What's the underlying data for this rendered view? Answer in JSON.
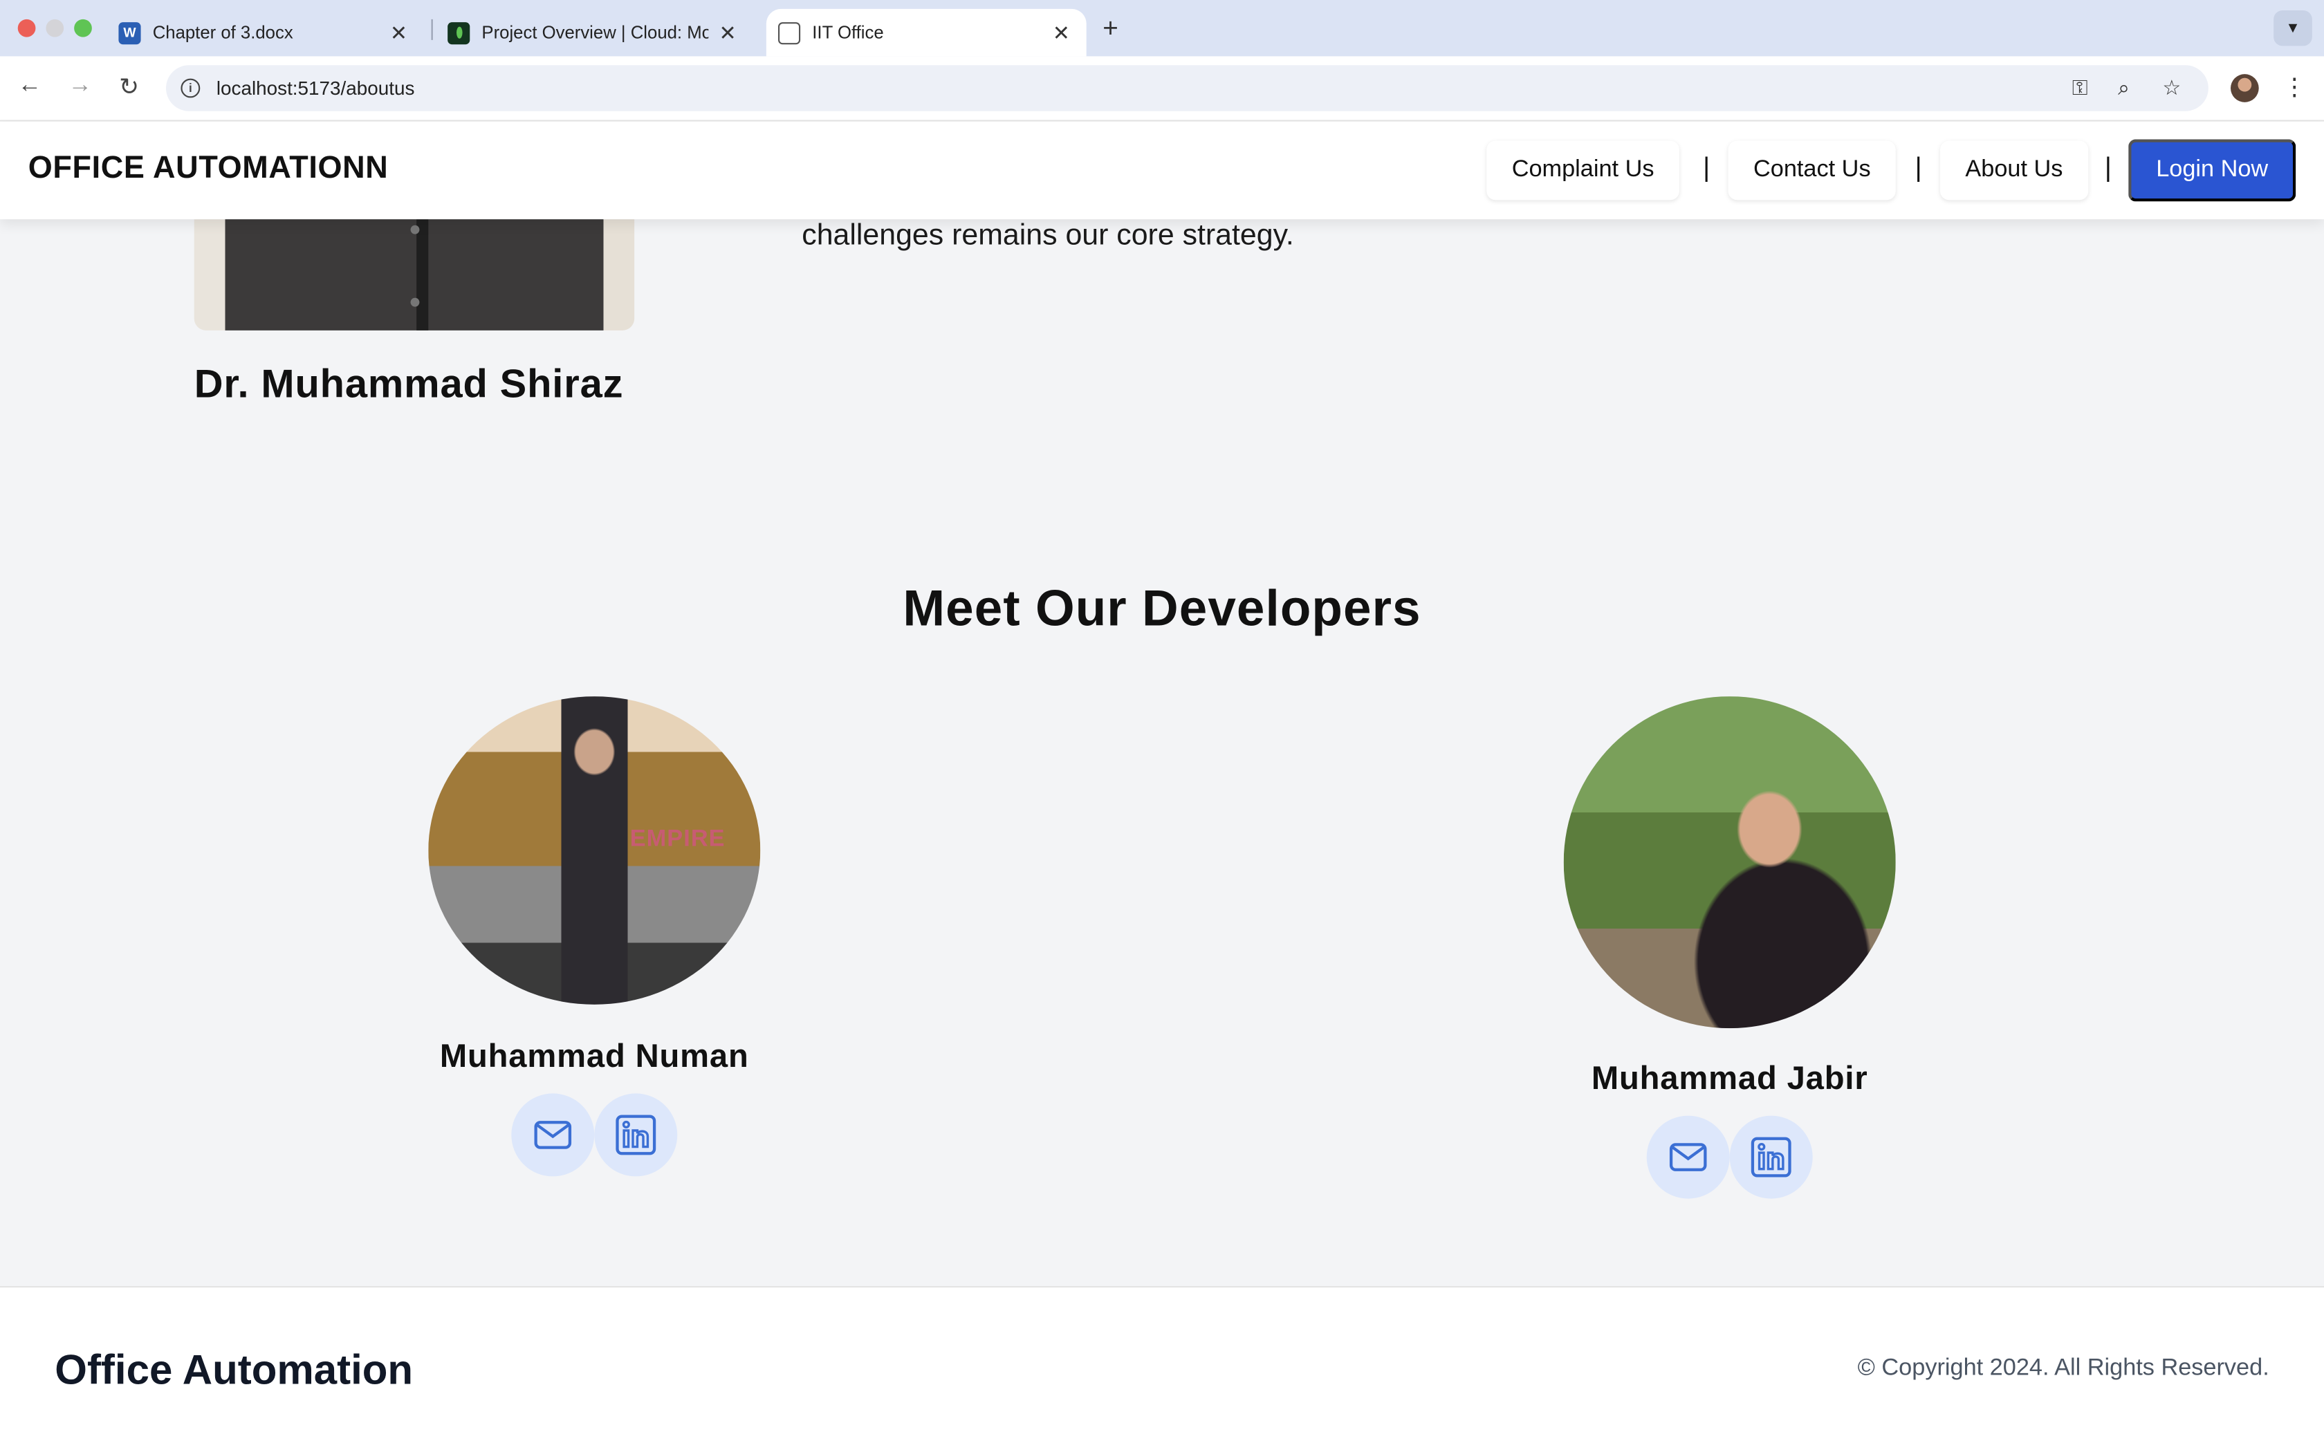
{
  "browser": {
    "tabs": [
      {
        "title": "Chapter of 3.docx",
        "icon": "word-icon",
        "active": false
      },
      {
        "title": "Project Overview | Cloud: MongoDB Cloud",
        "icon": "mongodb-icon",
        "active": false
      },
      {
        "title": "IIT Office",
        "icon": "globe-icon",
        "active": true
      }
    ],
    "url": "localhost:5173/aboutus"
  },
  "header": {
    "brand": "OFFICE AUTOMATIONN",
    "nav": [
      {
        "label": "Complaint Us"
      },
      {
        "label": "Contact Us"
      },
      {
        "label": "About Us"
      }
    ],
    "separator": "|",
    "login_label": "Login Now",
    "accent": "#2a55d2"
  },
  "director": {
    "quote_tail": "challenges remains our core strategy.",
    "name": "Dr. Muhammad Shiraz"
  },
  "developers": {
    "heading": "Meet Our Developers",
    "people": [
      {
        "name": "Muhammad Numan",
        "photo_sign": "EMPIRE",
        "links": [
          "mail-icon",
          "linkedin-icon"
        ]
      },
      {
        "name": "Muhammad Jabir",
        "links": [
          "mail-icon",
          "linkedin-icon"
        ]
      }
    ]
  },
  "footer": {
    "brand": "Office Automation",
    "copyright": "© Copyright 2024. All Rights Reserved."
  }
}
